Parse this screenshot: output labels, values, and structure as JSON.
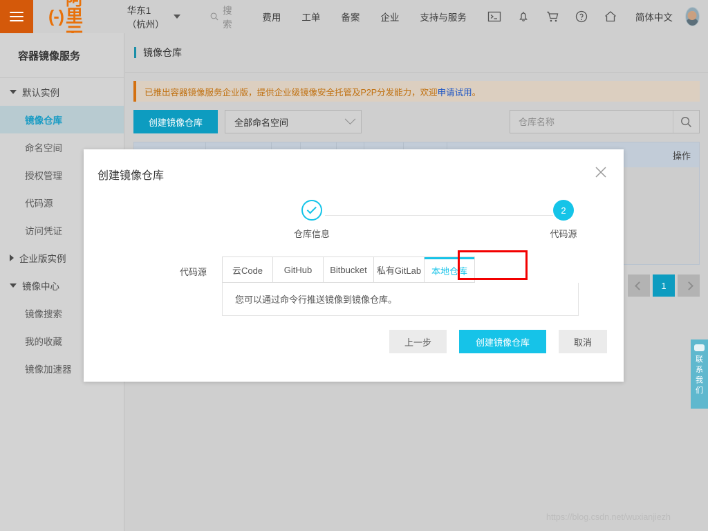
{
  "header": {
    "menu_icon": "hamburger-icon",
    "logo_mark": "(-)",
    "logo_text": "阿里云",
    "region": "华东1（杭州）",
    "search_label": "搜索",
    "nav": [
      {
        "label": "费用"
      },
      {
        "label": "工单"
      },
      {
        "label": "备案"
      },
      {
        "label": "企业"
      },
      {
        "label": "支持与服务"
      }
    ],
    "icons": [
      "terminal-icon",
      "bell-icon",
      "cart-icon",
      "help-icon",
      "home-icon"
    ],
    "language": "简体中文",
    "avatar": "user-avatar"
  },
  "sidebar": {
    "title": "容器镜像服务",
    "groups": [
      {
        "label": "默认实例",
        "expanded": true,
        "items": [
          {
            "label": "镜像仓库",
            "active": true
          },
          {
            "label": "命名空间",
            "active": false
          },
          {
            "label": "授权管理",
            "active": false
          },
          {
            "label": "代码源",
            "active": false
          },
          {
            "label": "访问凭证",
            "active": false
          }
        ]
      },
      {
        "label": "企业版实例",
        "expanded": false,
        "items": []
      },
      {
        "label": "镜像中心",
        "expanded": true,
        "items": [
          {
            "label": "镜像搜索",
            "active": false
          },
          {
            "label": "我的收藏",
            "active": false
          },
          {
            "label": "镜像加速器",
            "active": false
          }
        ]
      }
    ]
  },
  "page": {
    "title": "镜像仓库",
    "banner": {
      "text_before": "已推出容器镜像服务企业版，提供企业级镜像安全托管及P2P分发能力，欢迎",
      "link": "申请试用",
      "text_after": "。"
    },
    "toolbar": {
      "create_button": "创建镜像仓库",
      "namespace_select": "全部命名空间",
      "search_placeholder": "仓库名称",
      "search_value": "",
      "search_icon": "search-icon"
    },
    "table": {
      "columns": [
        "",
        "",
        "",
        "",
        "",
        "",
        "",
        "操作"
      ]
    },
    "pagination": {
      "prev": "‹",
      "pages": [
        "1"
      ],
      "current": "1",
      "next": "›"
    }
  },
  "contact_tab": {
    "text": "联系我们",
    "chars": [
      "联",
      "系",
      "我",
      "们"
    ]
  },
  "watermark": "https://blog.csdn.net/wuxianjiezh",
  "modal": {
    "title": "创建镜像仓库",
    "close_icon": "close-icon",
    "steps": [
      {
        "number": "",
        "label": "仓库信息",
        "state": "done"
      },
      {
        "number": "2",
        "label": "代码源",
        "state": "current"
      }
    ],
    "form": {
      "label": "代码源",
      "tabs": [
        {
          "label": "云Code",
          "selected": false
        },
        {
          "label": "GitHub",
          "selected": false
        },
        {
          "label": "Bitbucket",
          "selected": false
        },
        {
          "label": "私有GitLab",
          "selected": false
        },
        {
          "label": "本地仓库",
          "selected": true
        }
      ],
      "info": "您可以通过命令行推送镜像到镜像仓库。"
    },
    "actions": {
      "prev": "上一步",
      "submit": "创建镜像仓库",
      "cancel": "取消"
    }
  },
  "colors": {
    "brand_orange": "#e8710a",
    "accent_cyan": "#16c3e8",
    "primary_button": "#0d9cc0",
    "highlight_red": "#f20000",
    "banner_text": "#c0700f",
    "link_blue": "#1b54c4"
  }
}
